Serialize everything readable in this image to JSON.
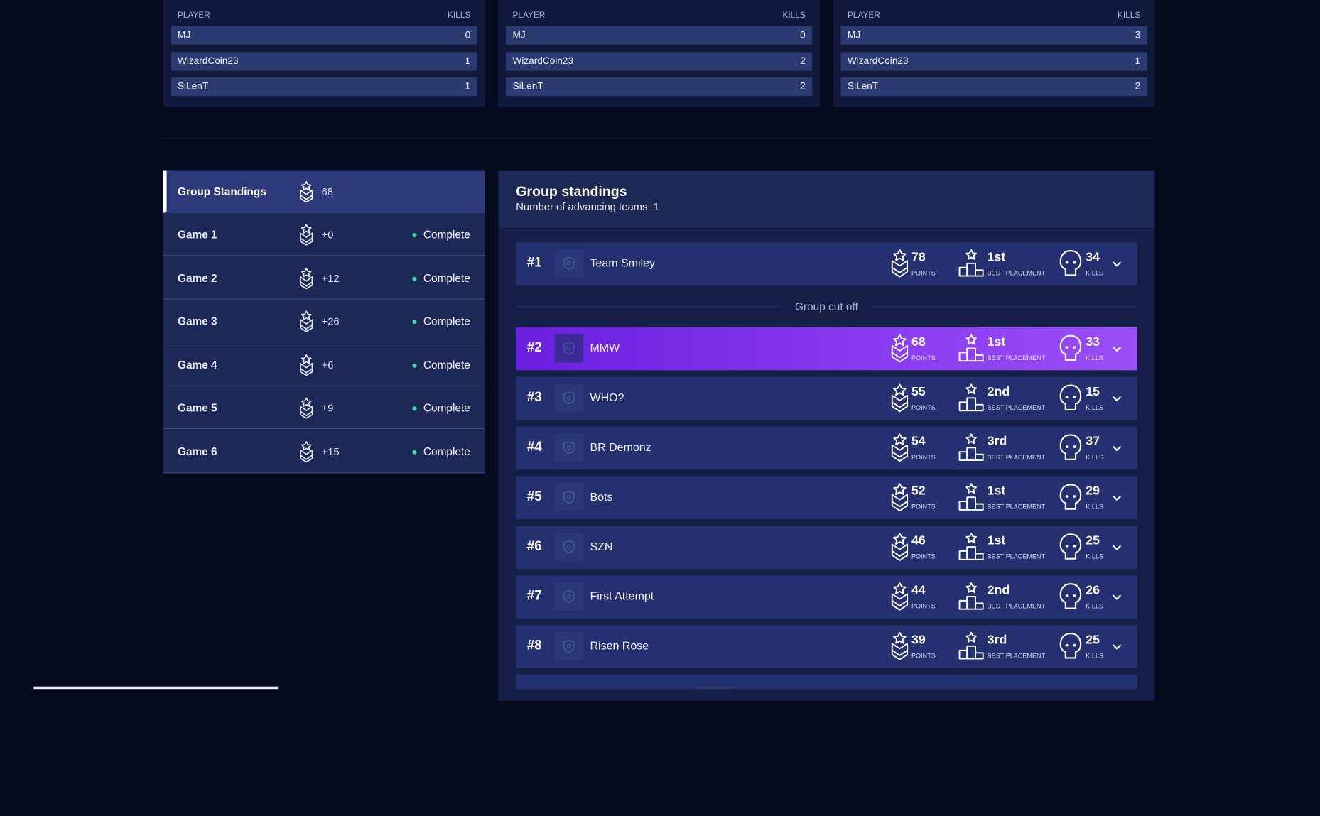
{
  "kill_tables": [
    {
      "header_player": "PLAYER",
      "header_kills": "KILLS",
      "rows": [
        {
          "player": "MJ",
          "kills": "0"
        },
        {
          "player": "WizardCoin23",
          "kills": "1"
        },
        {
          "player": "SiLenT",
          "kills": "1"
        }
      ]
    },
    {
      "header_player": "PLAYER",
      "header_kills": "KILLS",
      "rows": [
        {
          "player": "MJ",
          "kills": "0"
        },
        {
          "player": "WizardCoin23",
          "kills": "2"
        },
        {
          "player": "SiLenT",
          "kills": "2"
        }
      ]
    },
    {
      "header_player": "PLAYER",
      "header_kills": "KILLS",
      "rows": [
        {
          "player": "MJ",
          "kills": "3"
        },
        {
          "player": "WizardCoin23",
          "kills": "1"
        },
        {
          "player": "SiLenT",
          "kills": "2"
        }
      ]
    }
  ],
  "sidebar": {
    "standings": {
      "label": "Group Standings",
      "points": "68"
    },
    "games": [
      {
        "label": "Game 1",
        "points": "+0",
        "status": "Complete"
      },
      {
        "label": "Game 2",
        "points": "+12",
        "status": "Complete"
      },
      {
        "label": "Game 3",
        "points": "+26",
        "status": "Complete"
      },
      {
        "label": "Game 4",
        "points": "+6",
        "status": "Complete"
      },
      {
        "label": "Game 5",
        "points": "+9",
        "status": "Complete"
      },
      {
        "label": "Game 6",
        "points": "+15",
        "status": "Complete"
      }
    ],
    "status_color": "#2be3a2"
  },
  "standings": {
    "title": "Group standings",
    "subtitle": "Number of advancing teams: 1",
    "cutoff_label": "Group cut off",
    "captions": {
      "points": "POINTS",
      "placement": "BEST PLACEMENT",
      "kills": "KILLS"
    },
    "teams": [
      {
        "rank": "#1",
        "name": "Team Smiley",
        "points": "78",
        "placement": "1st",
        "kills": "34"
      },
      {
        "rank": "#2",
        "name": "MMW",
        "points": "68",
        "placement": "1st",
        "kills": "33",
        "highlight": true
      },
      {
        "rank": "#3",
        "name": "WHO?",
        "points": "55",
        "placement": "2nd",
        "kills": "15"
      },
      {
        "rank": "#4",
        "name": "BR Demonz",
        "points": "54",
        "placement": "3rd",
        "kills": "37"
      },
      {
        "rank": "#5",
        "name": "Bots",
        "points": "52",
        "placement": "1st",
        "kills": "29"
      },
      {
        "rank": "#6",
        "name": "SZN",
        "points": "46",
        "placement": "1st",
        "kills": "25"
      },
      {
        "rank": "#7",
        "name": "First Attempt",
        "points": "44",
        "placement": "2nd",
        "kills": "26"
      },
      {
        "rank": "#8",
        "name": "Risen Rose",
        "points": "39",
        "placement": "3rd",
        "kills": "25"
      }
    ],
    "highlight_color": "#7b2ff0",
    "icons": {
      "points": "chevron-badge-icon",
      "placement": "podium-star-icon",
      "kills": "skull-icon",
      "expand": "chevron-down-icon",
      "logo": "shield-icon"
    }
  }
}
